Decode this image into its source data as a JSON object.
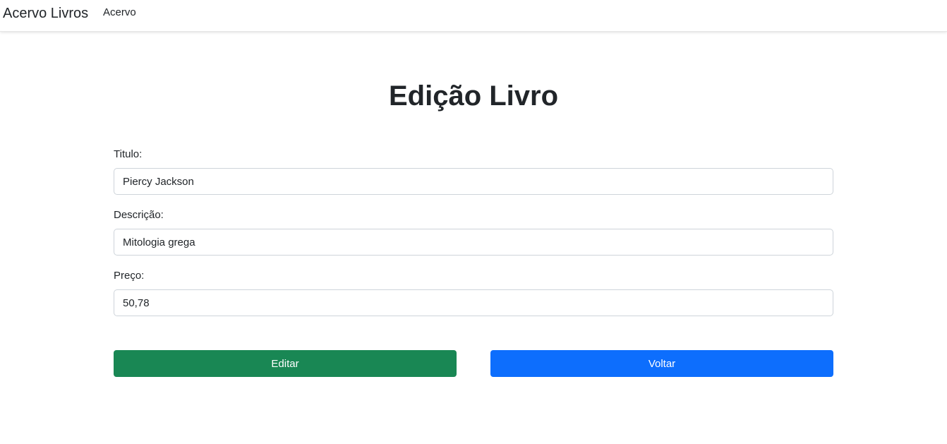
{
  "navbar": {
    "brand": "Acervo Livros",
    "link": "Acervo"
  },
  "page": {
    "title": "Edição Livro"
  },
  "form": {
    "titulo": {
      "label": "Titulo:",
      "value": "Piercy Jackson"
    },
    "descricao": {
      "label": "Descrição:",
      "value": "Mitologia grega"
    },
    "preco": {
      "label": "Preço:",
      "value": "50,78"
    }
  },
  "buttons": {
    "edit_label": "Editar",
    "back_label": "Voltar"
  },
  "colors": {
    "edit_button": "#198754",
    "back_button": "#0d6efd",
    "text": "#212529",
    "input_border": "#ced4da"
  }
}
